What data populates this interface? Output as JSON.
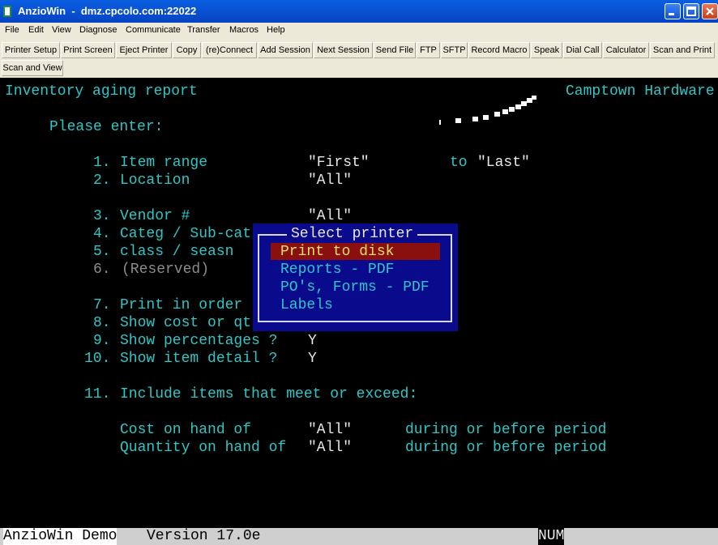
{
  "window": {
    "title": "AnzioWin  -  dmz.cpcolo.com:22022",
    "accent_color": "#0a53d6"
  },
  "menu": [
    "File",
    "Edit",
    "View",
    "Diagnose",
    "Communicate",
    "Transfer",
    "Macros",
    "Help"
  ],
  "toolbar": [
    "Printer Setup",
    "Print Screen",
    "Eject Printer",
    "Copy",
    "(re)Connect",
    "Add Session",
    "Next Session",
    "Send File",
    "FTP",
    "SFTP",
    "Record Macro",
    "Speak",
    "Dial Call",
    "Calculator",
    "Scan and Print",
    "Scan and View"
  ],
  "terminal": {
    "report_title": "Inventory aging report",
    "company": "Camptown Hardware",
    "prompt": "Please enter:",
    "fields": [
      {
        "num": "1.",
        "label": "Item range",
        "value": "\"First\"",
        "extra_label": "to",
        "extra_value": "\"Last\""
      },
      {
        "num": "2.",
        "label": "Location",
        "value": "\"All\""
      },
      {
        "num": "3.",
        "label": "Vendor #",
        "value": "\"All\""
      },
      {
        "num": "4.",
        "label": "Categ / Sub-cat"
      },
      {
        "num": "5.",
        "label": "class / seasn"
      },
      {
        "num": "6.",
        "label": "(Reserved)"
      },
      {
        "num": "7.",
        "label": "Print in order"
      },
      {
        "num": "8.",
        "label": "Show cost or qt"
      },
      {
        "num": "9.",
        "label": "Show percentages ?",
        "value": "Y"
      },
      {
        "num": "10.",
        "label": "Show item detail ?",
        "value": "Y"
      },
      {
        "num": "11.",
        "label": "Include items that meet or exceed:"
      }
    ],
    "thresholds": [
      {
        "label": "Cost on hand of",
        "value": "\"All\"",
        "note": "during or before period"
      },
      {
        "label": "Quantity on hand of",
        "value": "\"All\"",
        "note": "during or before period"
      }
    ]
  },
  "dialog": {
    "title": "Select printer",
    "options": [
      "Print to disk",
      "Reports - PDF",
      "PO's, Forms - PDF",
      "Labels"
    ],
    "selected_index": 0
  },
  "status": {
    "app": "AnzioWin Demo",
    "version": "Version 17.0e",
    "numlock": "NUM"
  }
}
